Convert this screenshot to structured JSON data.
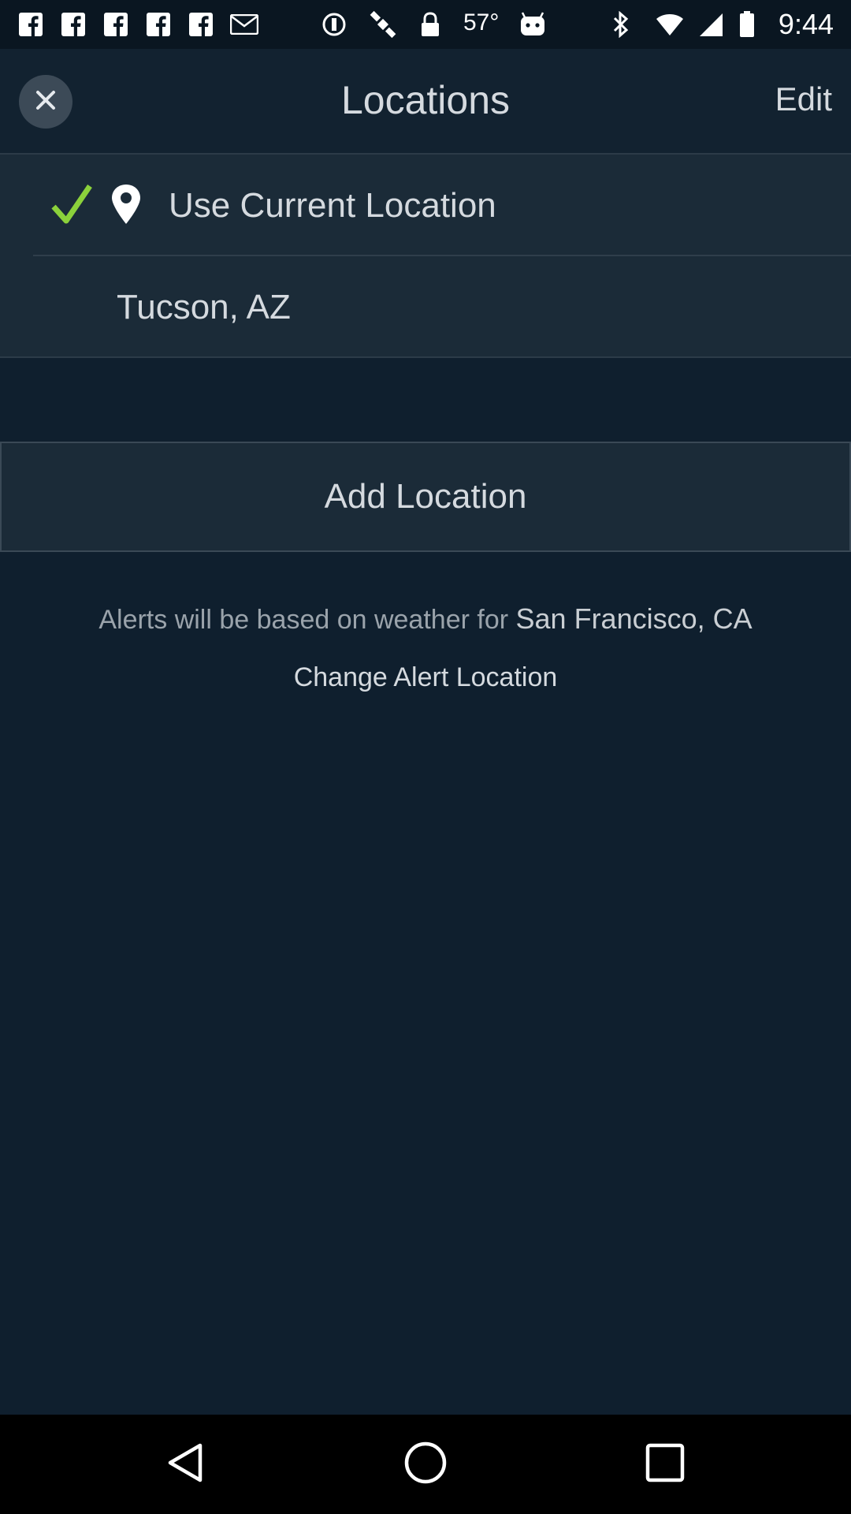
{
  "status_bar": {
    "temperature": "57°",
    "time": "9:44"
  },
  "header": {
    "title": "Locations",
    "edit_label": "Edit"
  },
  "locations": [
    {
      "label": "Use Current Location",
      "selected": true
    },
    {
      "label": "Tucson, AZ",
      "selected": false
    }
  ],
  "add_location_label": "Add Location",
  "alerts": {
    "prefix": "Alerts will be based on weather for ",
    "city": "San Francisco, CA",
    "change_label": "Change Alert Location"
  },
  "colors": {
    "background": "#0f1f2e",
    "list_background": "#1b2b38",
    "check": "#8bd13b",
    "text": "#d5dadf"
  },
  "icons": {
    "close": "close-icon",
    "check": "checkmark-icon",
    "pin": "location-pin-icon",
    "nav_back": "back-triangle-icon",
    "nav_home": "home-circle-icon",
    "nav_recents": "recents-square-icon"
  }
}
